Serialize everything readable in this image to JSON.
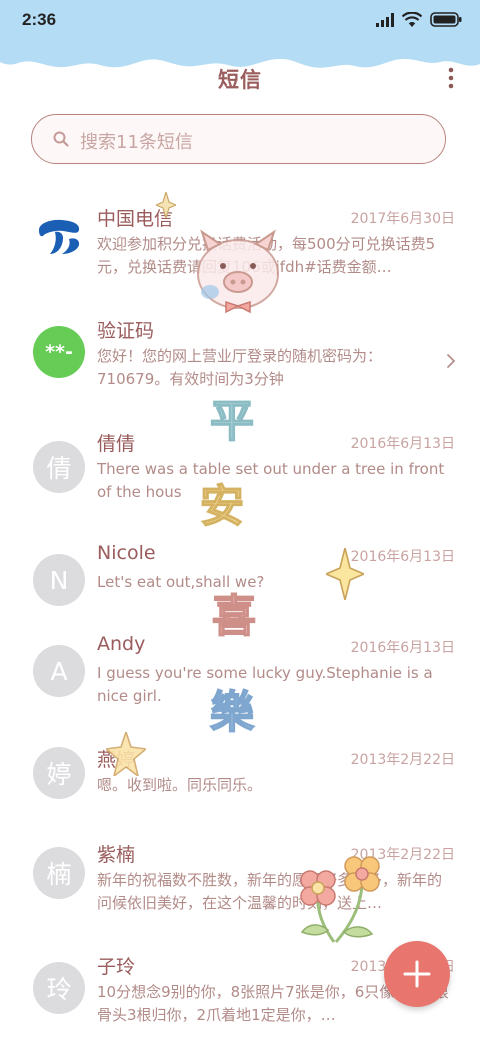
{
  "status_bar": {
    "time": "2:36",
    "icons": [
      "signal-icon",
      "wifi-icon",
      "battery-icon"
    ]
  },
  "header": {
    "title": "短信",
    "more_icon": "more-vertical-icon"
  },
  "search": {
    "placeholder": "搜索11条短信",
    "icon": "search-icon"
  },
  "conversations": [
    {
      "name": "中国电信",
      "date": "2017年6月30日",
      "avatar": "",
      "avatar_icon": "china-telecom-logo-icon",
      "message": "欢迎参加积分兑换话费活动，每500分可兑换话费5元，兑换话费请回复106或jfdh#话费金额…"
    },
    {
      "name": "验证码",
      "date": "",
      "avatar": "**-",
      "avatar_icon": "verification-code-icon",
      "message": "您好！您的网上营业厅登录的随机密码为：710679。有效时间为3分钟"
    },
    {
      "name": "倩倩",
      "date": "2016年6月13日",
      "avatar": "倩",
      "message": "There was a table set out under a tree in front of the hous"
    },
    {
      "name": "Nicole",
      "date": "2016年6月13日",
      "avatar": "N",
      "message": "Let's eat out,shall we?"
    },
    {
      "name": "Andy",
      "date": "2016年6月13日",
      "avatar": "A",
      "message": "I guess you're some lucky guy.Stephanie is a nice girl."
    },
    {
      "name": "燕婷",
      "date": "2013年2月22日",
      "avatar": "婷",
      "message": "嗯。收到啦。同乐同乐。"
    },
    {
      "name": "紫楠",
      "date": "2013年2月22日",
      "avatar": "楠",
      "message": "新年的祝福数不胜数，新年的愿望好多好多，新年的问候依旧美好，在这个温馨的时刻，送上…"
    },
    {
      "name": "子玲",
      "date": "2013年2月22日",
      "avatar": "玲",
      "message": "10分想念9别的你，8张照片7张是你，6只像你，4根骨头3根归你，2爪着地1定是你，…"
    }
  ],
  "deco_text": [
    "平",
    "安",
    "喜",
    "樂"
  ],
  "colors": {
    "accent": "#e8766e",
    "title": "#9a5c5c",
    "sky": "#b4dcf5",
    "verify_avatar": "#66cc55",
    "telecom_blue": "#1a5fb4"
  },
  "fab": {
    "icon": "plus-icon"
  }
}
